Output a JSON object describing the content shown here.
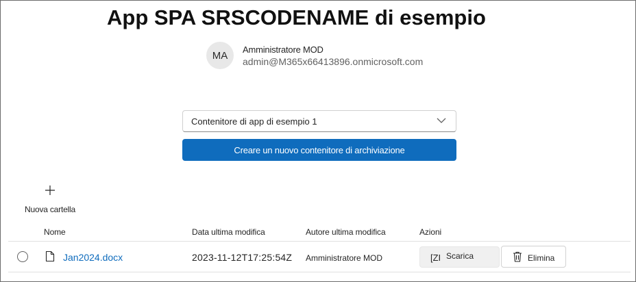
{
  "page": {
    "title": "App SPA SRSCODENAME di esempio"
  },
  "user": {
    "initials": "MA",
    "name": "Amministratore MOD",
    "email": "admin@M365x66413896.onmicrosoft.com"
  },
  "container_select": {
    "selected": "Contenitore di app di esempio 1"
  },
  "create_container_button": {
    "label": "Creare un nuovo contenitore di archiviazione"
  },
  "toolbar": {
    "new_folder_label": "Nuova cartella"
  },
  "table": {
    "columns": [
      "Nome",
      "Data ultima modifica",
      "Autore ultima modifica",
      "Azioni"
    ],
    "rows": [
      {
        "name": "Jan2024.docx",
        "modified": "2023-11-12T17:25:54Z",
        "author": "Amministratore MOD",
        "download_prefix": "[ZI",
        "download_label": "Scarica",
        "delete_label": "Elimina"
      }
    ]
  },
  "colors": {
    "accent": "#0f6cbd",
    "link": "#0f6cbd",
    "avatar_bg": "#e8e8e8"
  },
  "icons": [
    "chevron-down-icon",
    "plus-icon",
    "radio-icon",
    "document-icon",
    "trash-icon"
  ]
}
